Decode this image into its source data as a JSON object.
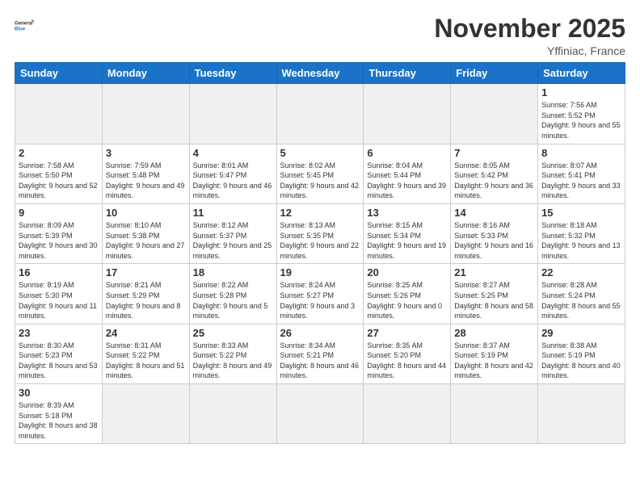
{
  "logo": {
    "text_general": "General",
    "text_blue": "Blue"
  },
  "header": {
    "month_title": "November 2025",
    "subtitle": "Yffiniac, France"
  },
  "weekdays": [
    "Sunday",
    "Monday",
    "Tuesday",
    "Wednesday",
    "Thursday",
    "Friday",
    "Saturday"
  ],
  "days": [
    {
      "num": "",
      "sunrise": "",
      "sunset": "",
      "daylight": ""
    },
    {
      "num": "",
      "sunrise": "",
      "sunset": "",
      "daylight": ""
    },
    {
      "num": "",
      "sunrise": "",
      "sunset": "",
      "daylight": ""
    },
    {
      "num": "",
      "sunrise": "",
      "sunset": "",
      "daylight": ""
    },
    {
      "num": "",
      "sunrise": "",
      "sunset": "",
      "daylight": ""
    },
    {
      "num": "",
      "sunrise": "",
      "sunset": "",
      "daylight": ""
    },
    {
      "num": "1",
      "sunrise": "Sunrise: 7:56 AM",
      "sunset": "Sunset: 5:52 PM",
      "daylight": "Daylight: 9 hours and 55 minutes."
    },
    {
      "num": "2",
      "sunrise": "Sunrise: 7:58 AM",
      "sunset": "Sunset: 5:50 PM",
      "daylight": "Daylight: 9 hours and 52 minutes."
    },
    {
      "num": "3",
      "sunrise": "Sunrise: 7:59 AM",
      "sunset": "Sunset: 5:48 PM",
      "daylight": "Daylight: 9 hours and 49 minutes."
    },
    {
      "num": "4",
      "sunrise": "Sunrise: 8:01 AM",
      "sunset": "Sunset: 5:47 PM",
      "daylight": "Daylight: 9 hours and 46 minutes."
    },
    {
      "num": "5",
      "sunrise": "Sunrise: 8:02 AM",
      "sunset": "Sunset: 5:45 PM",
      "daylight": "Daylight: 9 hours and 42 minutes."
    },
    {
      "num": "6",
      "sunrise": "Sunrise: 8:04 AM",
      "sunset": "Sunset: 5:44 PM",
      "daylight": "Daylight: 9 hours and 39 minutes."
    },
    {
      "num": "7",
      "sunrise": "Sunrise: 8:05 AM",
      "sunset": "Sunset: 5:42 PM",
      "daylight": "Daylight: 9 hours and 36 minutes."
    },
    {
      "num": "8",
      "sunrise": "Sunrise: 8:07 AM",
      "sunset": "Sunset: 5:41 PM",
      "daylight": "Daylight: 9 hours and 33 minutes."
    },
    {
      "num": "9",
      "sunrise": "Sunrise: 8:09 AM",
      "sunset": "Sunset: 5:39 PM",
      "daylight": "Daylight: 9 hours and 30 minutes."
    },
    {
      "num": "10",
      "sunrise": "Sunrise: 8:10 AM",
      "sunset": "Sunset: 5:38 PM",
      "daylight": "Daylight: 9 hours and 27 minutes."
    },
    {
      "num": "11",
      "sunrise": "Sunrise: 8:12 AM",
      "sunset": "Sunset: 5:37 PM",
      "daylight": "Daylight: 9 hours and 25 minutes."
    },
    {
      "num": "12",
      "sunrise": "Sunrise: 8:13 AM",
      "sunset": "Sunset: 5:35 PM",
      "daylight": "Daylight: 9 hours and 22 minutes."
    },
    {
      "num": "13",
      "sunrise": "Sunrise: 8:15 AM",
      "sunset": "Sunset: 5:34 PM",
      "daylight": "Daylight: 9 hours and 19 minutes."
    },
    {
      "num": "14",
      "sunrise": "Sunrise: 8:16 AM",
      "sunset": "Sunset: 5:33 PM",
      "daylight": "Daylight: 9 hours and 16 minutes."
    },
    {
      "num": "15",
      "sunrise": "Sunrise: 8:18 AM",
      "sunset": "Sunset: 5:32 PM",
      "daylight": "Daylight: 9 hours and 13 minutes."
    },
    {
      "num": "16",
      "sunrise": "Sunrise: 8:19 AM",
      "sunset": "Sunset: 5:30 PM",
      "daylight": "Daylight: 9 hours and 11 minutes."
    },
    {
      "num": "17",
      "sunrise": "Sunrise: 8:21 AM",
      "sunset": "Sunset: 5:29 PM",
      "daylight": "Daylight: 9 hours and 8 minutes."
    },
    {
      "num": "18",
      "sunrise": "Sunrise: 8:22 AM",
      "sunset": "Sunset: 5:28 PM",
      "daylight": "Daylight: 9 hours and 5 minutes."
    },
    {
      "num": "19",
      "sunrise": "Sunrise: 8:24 AM",
      "sunset": "Sunset: 5:27 PM",
      "daylight": "Daylight: 9 hours and 3 minutes."
    },
    {
      "num": "20",
      "sunrise": "Sunrise: 8:25 AM",
      "sunset": "Sunset: 5:26 PM",
      "daylight": "Daylight: 9 hours and 0 minutes."
    },
    {
      "num": "21",
      "sunrise": "Sunrise: 8:27 AM",
      "sunset": "Sunset: 5:25 PM",
      "daylight": "Daylight: 8 hours and 58 minutes."
    },
    {
      "num": "22",
      "sunrise": "Sunrise: 8:28 AM",
      "sunset": "Sunset: 5:24 PM",
      "daylight": "Daylight: 8 hours and 55 minutes."
    },
    {
      "num": "23",
      "sunrise": "Sunrise: 8:30 AM",
      "sunset": "Sunset: 5:23 PM",
      "daylight": "Daylight: 8 hours and 53 minutes."
    },
    {
      "num": "24",
      "sunrise": "Sunrise: 8:31 AM",
      "sunset": "Sunset: 5:22 PM",
      "daylight": "Daylight: 8 hours and 51 minutes."
    },
    {
      "num": "25",
      "sunrise": "Sunrise: 8:33 AM",
      "sunset": "Sunset: 5:22 PM",
      "daylight": "Daylight: 8 hours and 49 minutes."
    },
    {
      "num": "26",
      "sunrise": "Sunrise: 8:34 AM",
      "sunset": "Sunset: 5:21 PM",
      "daylight": "Daylight: 8 hours and 46 minutes."
    },
    {
      "num": "27",
      "sunrise": "Sunrise: 8:35 AM",
      "sunset": "Sunset: 5:20 PM",
      "daylight": "Daylight: 8 hours and 44 minutes."
    },
    {
      "num": "28",
      "sunrise": "Sunrise: 8:37 AM",
      "sunset": "Sunset: 5:19 PM",
      "daylight": "Daylight: 8 hours and 42 minutes."
    },
    {
      "num": "29",
      "sunrise": "Sunrise: 8:38 AM",
      "sunset": "Sunset: 5:19 PM",
      "daylight": "Daylight: 8 hours and 40 minutes."
    },
    {
      "num": "30",
      "sunrise": "Sunrise: 8:39 AM",
      "sunset": "Sunset: 5:18 PM",
      "daylight": "Daylight: 8 hours and 38 minutes."
    }
  ]
}
